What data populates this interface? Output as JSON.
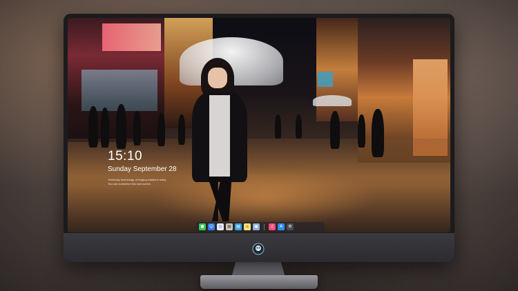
{
  "lock_screen": {
    "time": "15:10",
    "date": "Sunday September 28",
    "notes": [
      "Yesterday technology, emerging solutions today",
      "You can customize this lock screen"
    ]
  },
  "dock": {
    "items": [
      {
        "name": "messages",
        "color": "#34c759"
      },
      {
        "name": "finder",
        "color": "#2d7bf4"
      },
      {
        "name": "safari",
        "color": "#e9e9ee"
      },
      {
        "name": "photos",
        "color": "#cfc6b4"
      },
      {
        "name": "files",
        "color": "#3aa0e8"
      },
      {
        "name": "notes",
        "color": "#f6e27a"
      },
      {
        "name": "preview",
        "color": "#8ab0d8"
      },
      {
        "name": "music",
        "color": "#f54a7a"
      },
      {
        "name": "app-store",
        "color": "#2f8cf5"
      },
      {
        "name": "settings",
        "color": "#4a4a52"
      }
    ]
  },
  "colors": {
    "accent_warm": "#e8a15a",
    "neon_pink": "#ff5f7a",
    "bezel": "#1b1b1e"
  }
}
